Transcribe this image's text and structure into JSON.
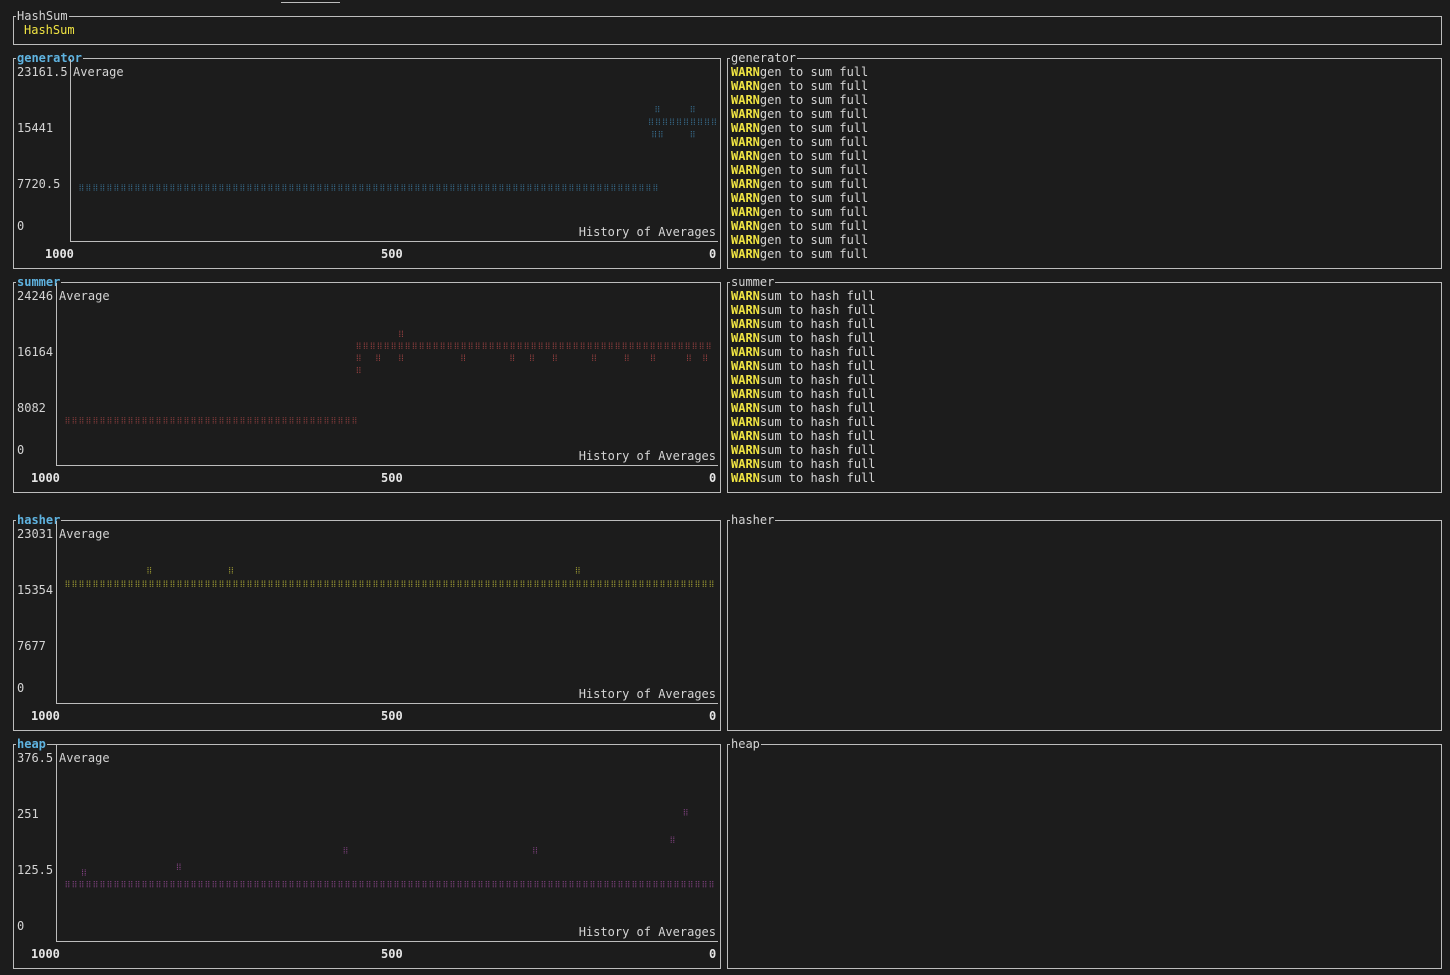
{
  "colors": {
    "generator": "#3d7fa8",
    "summer": "#b04848",
    "hasher": "#c9c53a",
    "heap": "#9b4c9b",
    "warn": "#f0e442"
  },
  "header": {
    "box_title": "HashSum",
    "label": "HashSum"
  },
  "panels": [
    {
      "key": "generator",
      "chart_title": "generator",
      "log_title": "generator",
      "chart_data": {
        "type": "scatter",
        "name": "Average",
        "footer": "History of Averages",
        "x_ticks": [
          "1000",
          "500",
          "0"
        ],
        "y_ticks": [
          "23161.5",
          "15441",
          "7720.5",
          "0"
        ],
        "xlim": [
          1000,
          0
        ],
        "ylim": [
          0,
          23161.5
        ],
        "series": [
          {
            "x_range": [
              990,
              90
            ],
            "y": 5200
          },
          {
            "x_range": [
              100,
              0
            ],
            "y": 15441
          }
        ],
        "extra_points": [
          [
            90,
            17400
          ],
          [
            35,
            17400
          ],
          [
            95,
            13500
          ],
          [
            85,
            13500
          ],
          [
            35,
            13500
          ]
        ]
      },
      "log_level": "WARN",
      "log_lines": [
        "gen to sum full",
        "gen to sum full",
        "gen to sum full",
        "gen to sum full",
        "gen to sum full",
        "gen to sum full",
        "gen to sum full",
        "gen to sum full",
        "gen to sum full",
        "gen to sum full",
        "gen to sum full",
        "gen to sum full",
        "gen to sum full",
        "gen to sum full"
      ]
    },
    {
      "key": "summer",
      "chart_title": "summer",
      "log_title": "summer",
      "chart_data": {
        "type": "scatter",
        "name": "Average",
        "footer": "History of Averages",
        "x_ticks": [
          "1000",
          "500",
          "0"
        ],
        "y_ticks": [
          "24246",
          "16164",
          "8082",
          "0"
        ],
        "xlim": [
          1000,
          0
        ],
        "ylim": [
          0,
          24246
        ],
        "series": [
          {
            "x_range": [
              990,
              545
            ],
            "y": 4000
          },
          {
            "x_range": [
              545,
              0
            ],
            "y": 16164
          }
        ],
        "extra_points": [
          [
            480,
            18100
          ],
          [
            545,
            14200
          ],
          [
            515,
            14200
          ],
          [
            480,
            14200
          ],
          [
            385,
            14200
          ],
          [
            310,
            14200
          ],
          [
            280,
            14200
          ],
          [
            245,
            14200
          ],
          [
            185,
            14200
          ],
          [
            135,
            14200
          ],
          [
            95,
            14200
          ],
          [
            40,
            14200
          ],
          [
            15,
            14200
          ],
          [
            545,
            12200
          ]
        ]
      },
      "log_level": "WARN",
      "log_lines": [
        "sum to hash full",
        "sum to hash full",
        "sum to hash full",
        "sum to hash full",
        "sum to hash full",
        "sum to hash full",
        "sum to hash full",
        "sum to hash full",
        "sum to hash full",
        "sum to hash full",
        "sum to hash full",
        "sum to hash full",
        "sum to hash full",
        "sum to hash full"
      ]
    },
    {
      "key": "hasher",
      "chart_title": "hasher",
      "log_title": "hasher",
      "chart_data": {
        "type": "scatter",
        "name": "Average",
        "footer": "History of Averages",
        "x_ticks": [
          "1000",
          "500",
          "0"
        ],
        "y_ticks": [
          "23031",
          "15354",
          "7677",
          "0"
        ],
        "xlim": [
          1000,
          0
        ],
        "ylim": [
          0,
          23031
        ],
        "series": [
          {
            "x_range": [
              990,
              0
            ],
            "y": 15354
          }
        ],
        "extra_points": [
          [
            865,
            17400
          ],
          [
            740,
            17400
          ],
          [
            210,
            17400
          ]
        ]
      },
      "log_level": "WARN",
      "log_lines": []
    },
    {
      "key": "heap",
      "chart_title": "heap",
      "log_title": "heap",
      "chart_data": {
        "type": "scatter",
        "name": "Average",
        "footer": "History of Averages",
        "x_ticks": [
          "1000",
          "500",
          "0"
        ],
        "y_ticks": [
          "376.5",
          "251",
          "125.5",
          "0"
        ],
        "xlim": [
          1000,
          0
        ],
        "ylim": [
          0,
          376.5
        ],
        "series": [
          {
            "x_range": [
              990,
              0
            ],
            "y": 85
          }
        ],
        "extra_points": [
          [
            965,
            112
          ],
          [
            820,
            125.5
          ],
          [
            565,
            163
          ],
          [
            275,
            163
          ],
          [
            65,
            188
          ],
          [
            45,
            251
          ]
        ]
      },
      "log_level": "WARN",
      "log_lines": []
    }
  ]
}
